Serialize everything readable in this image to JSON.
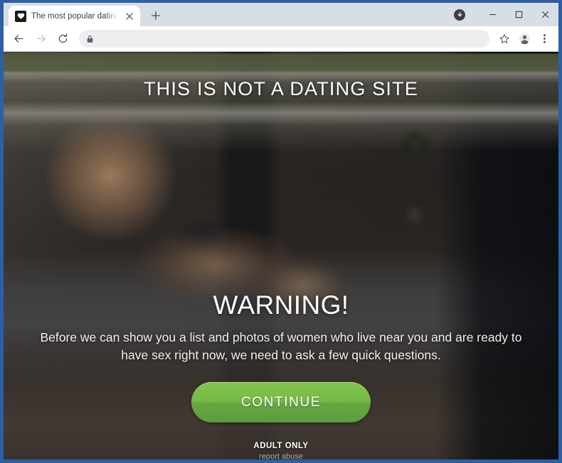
{
  "window": {
    "controls": {
      "download_icon": "download-circle-icon",
      "minimize": "minimize-icon",
      "maximize": "maximize-icon",
      "close": "close-icon"
    },
    "frame_color": "#2e5fa3"
  },
  "tabstrip": {
    "tabs": [
      {
        "title": "The most popular dating site of t",
        "favicon": "heart-favicon",
        "close_label": "✕"
      }
    ],
    "new_tab_label": "+"
  },
  "toolbar": {
    "back_icon": "back-arrow-icon",
    "forward_icon": "forward-arrow-icon",
    "reload_icon": "reload-icon",
    "lock_icon": "lock-icon",
    "url": "",
    "url_placeholder": "",
    "bookmark_icon": "star-icon",
    "profile_icon": "profile-avatar-icon",
    "menu_icon": "three-dot-menu-icon"
  },
  "page": {
    "headline": "THIS IS NOT A DATING SITE",
    "warning_title": "WARNING!",
    "warning_body": "Before we can show you a list and photos of women who live near you and are ready to have sex right now, we need to ask a few quick questions.",
    "continue_label": "CONTINUE",
    "continue_color": "#76bb45",
    "footer": {
      "adult_only": "ADULT ONLY",
      "report_abuse": "report abuse"
    }
  }
}
